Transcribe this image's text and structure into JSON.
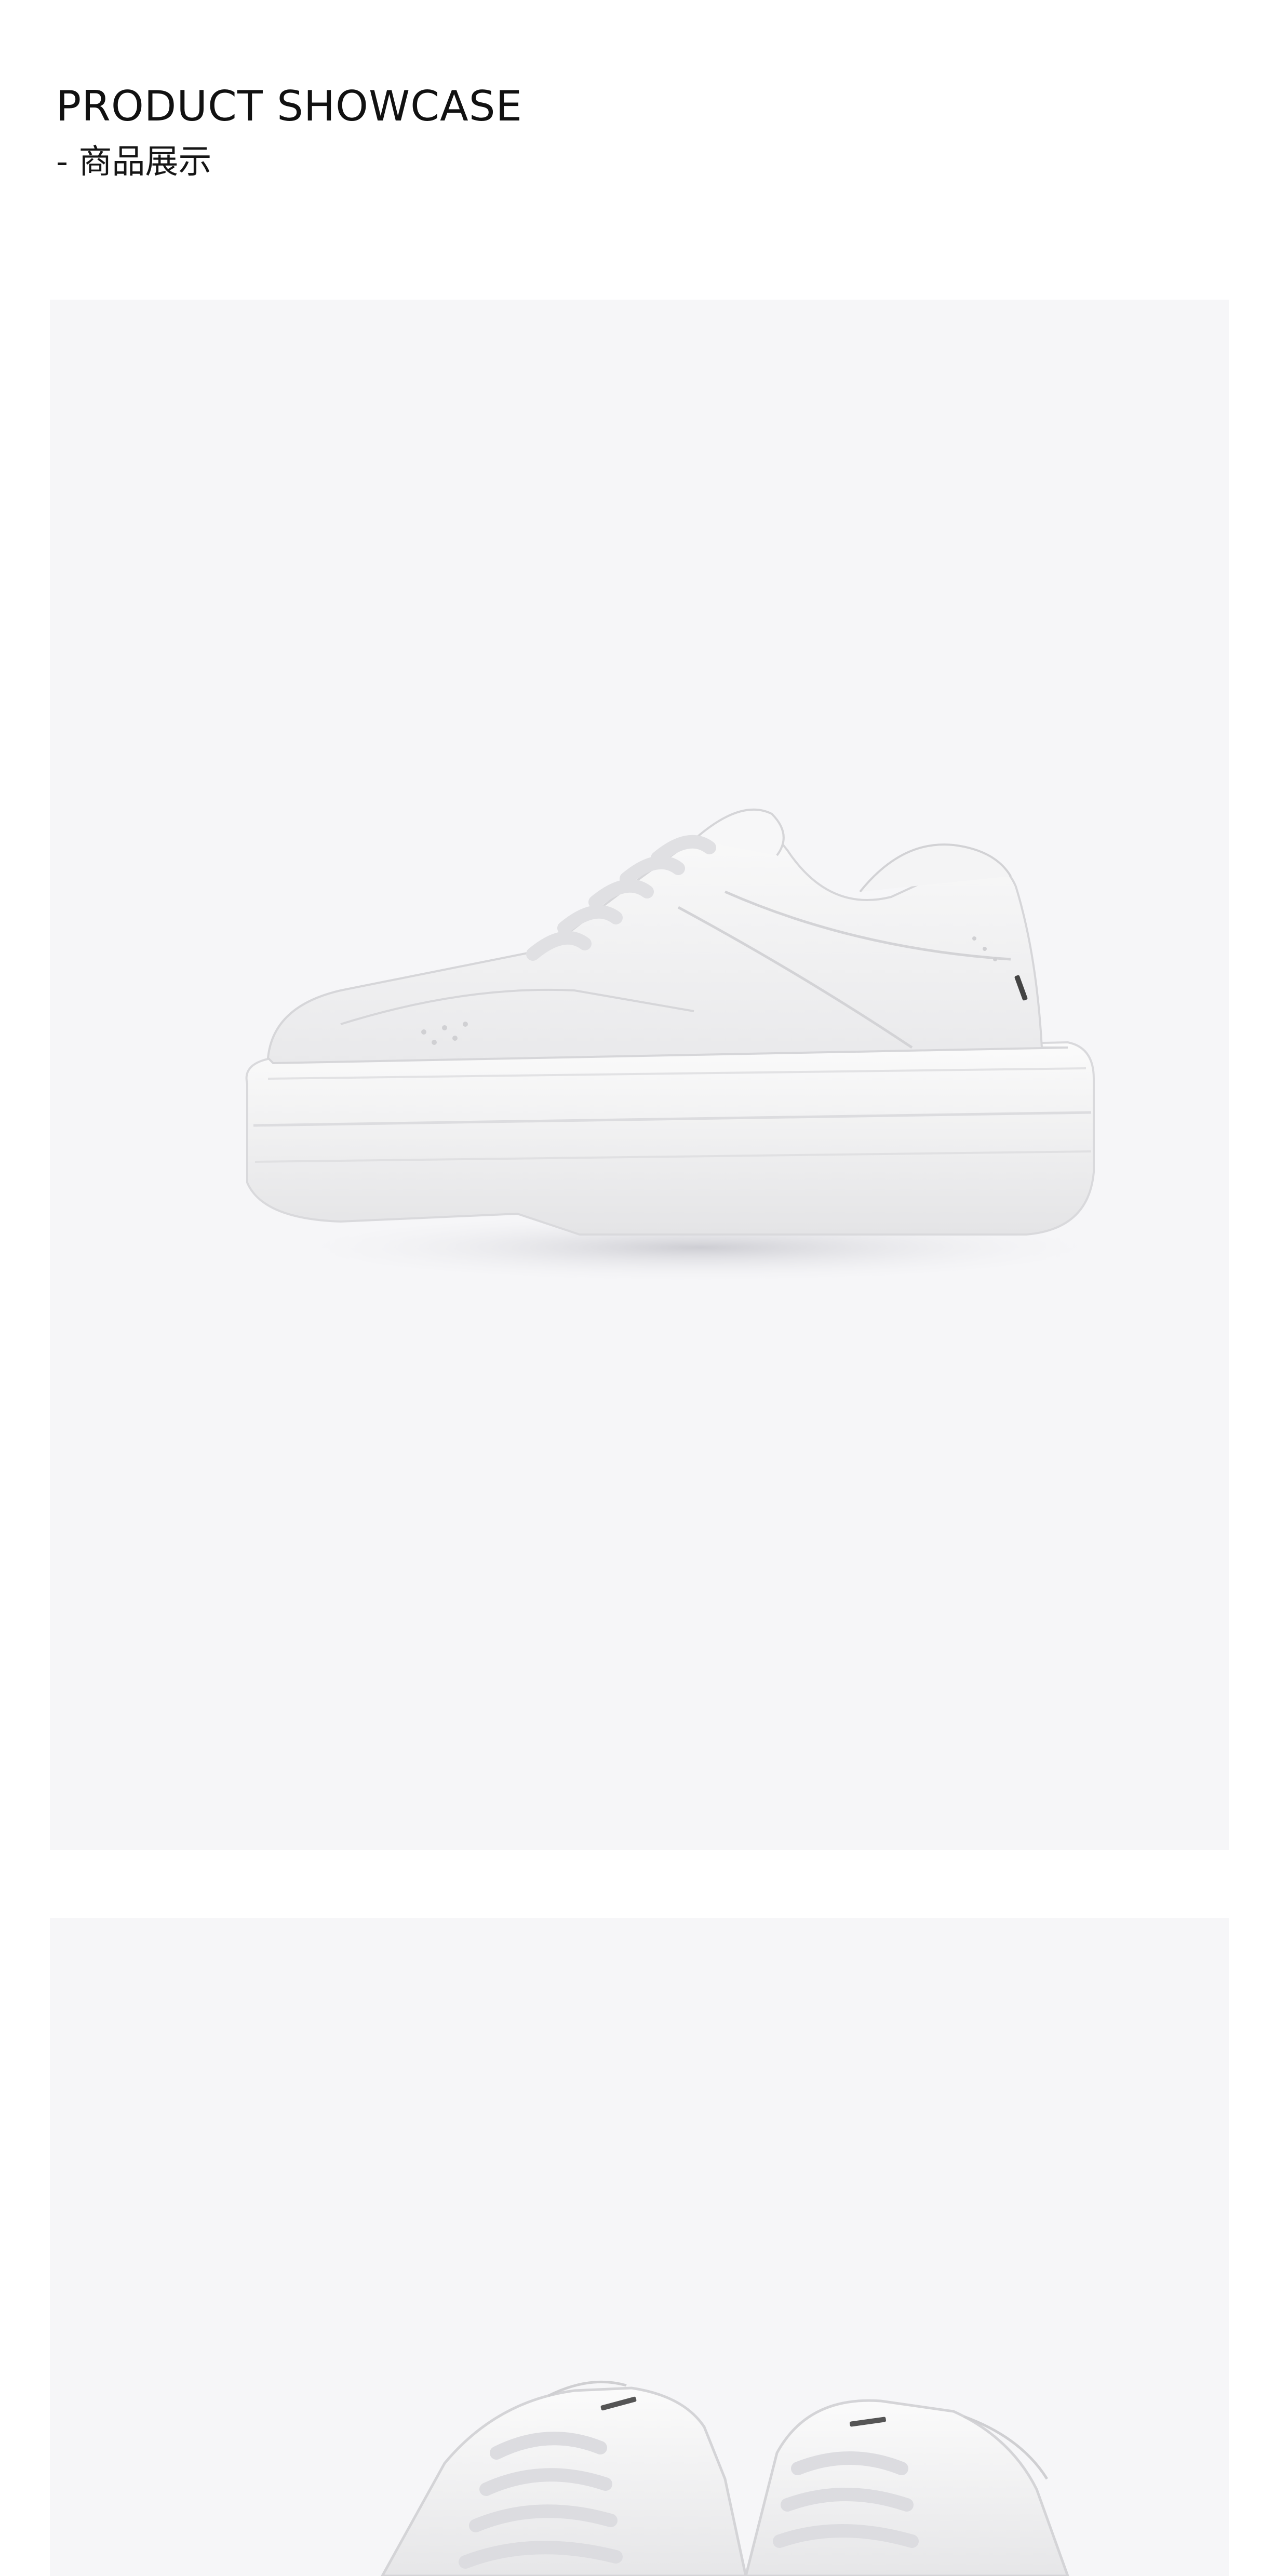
{
  "showcase": {
    "title": "PRODUCT SHOWCASE",
    "subtitle": "- 商品展示"
  },
  "photos": [
    {
      "icon": "white-platform-sneaker-side-view",
      "background": "#f6f6f8"
    },
    {
      "icon": "white-platform-sneaker-pair-top-view",
      "background": "#f6f6f8"
    }
  ],
  "colors": {
    "page_background": "#ffffff",
    "photo_background": "#f6f6f8",
    "shoe_white": "#f3f3f3",
    "text": "#111111"
  }
}
